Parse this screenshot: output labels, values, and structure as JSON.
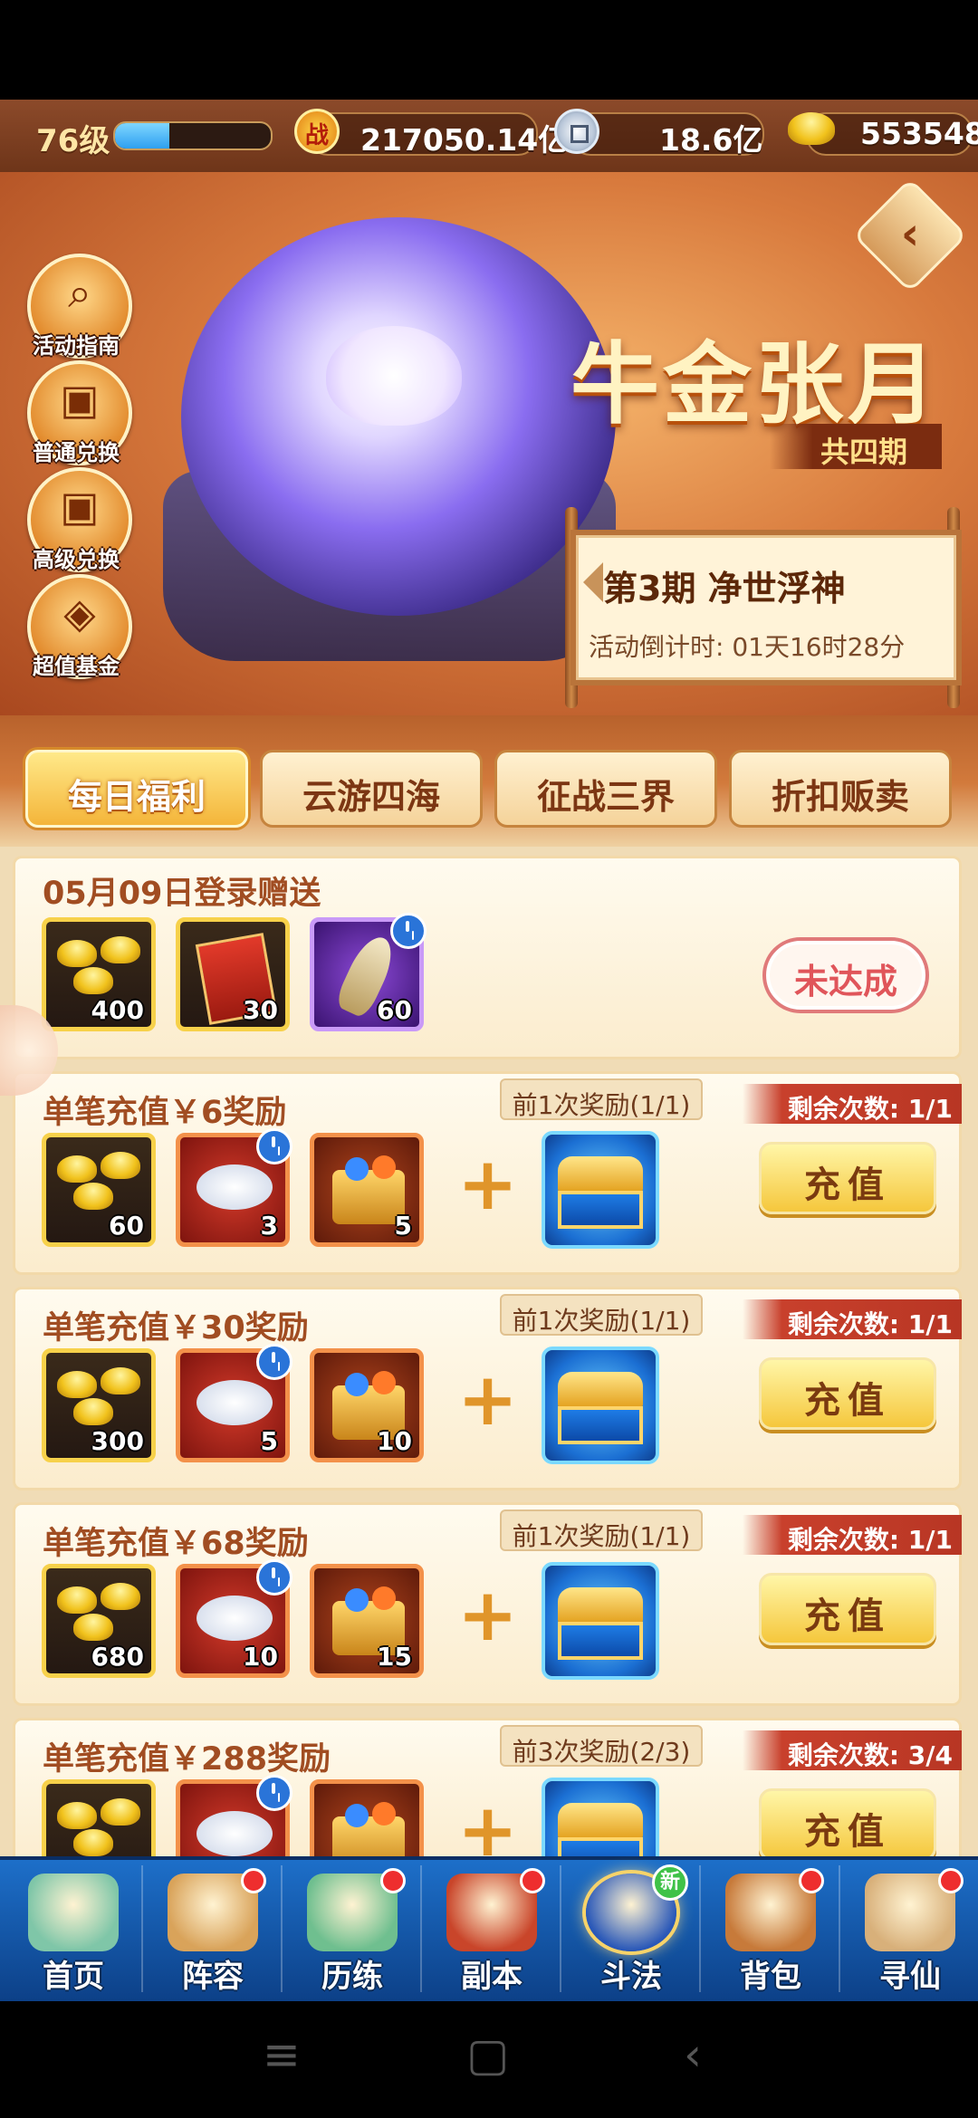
{
  "top_bar": {
    "level": "76级",
    "xp_progress": 0.35,
    "combat_icon": "战",
    "combat_power": "217050.14亿",
    "silver": "18.6亿",
    "gold": "553548"
  },
  "side_menu": [
    {
      "label": "活动指南",
      "icon": "magnifier-icon"
    },
    {
      "label": "普通兑换",
      "icon": "gift-box-icon"
    },
    {
      "label": "高级兑换",
      "icon": "gift-box-icon"
    },
    {
      "label": "超值基金",
      "icon": "treasure-icon"
    }
  ],
  "banner": {
    "title": "牛金张月",
    "subtitle": "共四期",
    "phase": "第3期  净世浮神",
    "countdown": "活动倒计时: 01天16时28分"
  },
  "tabs": [
    "每日福利",
    "云游四海",
    "征战三界",
    "折扣贩卖"
  ],
  "login_card": {
    "title": "05月09日登录赠送",
    "items": [
      {
        "type": "gold-ingot",
        "qty": "400"
      },
      {
        "type": "music-scroll",
        "qty": "30"
      },
      {
        "type": "bamboo-shoot",
        "qty": "60"
      }
    ],
    "status": "未达成"
  },
  "recharge_cards": [
    {
      "title": "单笔充值￥6奖励",
      "first_reward": "前1次奖励(1/1)",
      "remaining": "剩余次数: 1/1",
      "items": [
        {
          "qty": "60"
        },
        {
          "qty": "3"
        },
        {
          "qty": "5"
        }
      ],
      "button": "充值"
    },
    {
      "title": "单笔充值￥30奖励",
      "first_reward": "前1次奖励(1/1)",
      "remaining": "剩余次数: 1/1",
      "items": [
        {
          "qty": "300"
        },
        {
          "qty": "5"
        },
        {
          "qty": "10"
        }
      ],
      "button": "充值"
    },
    {
      "title": "单笔充值￥68奖励",
      "first_reward": "前1次奖励(1/1)",
      "remaining": "剩余次数: 1/1",
      "items": [
        {
          "qty": "680"
        },
        {
          "qty": "10"
        },
        {
          "qty": "15"
        }
      ],
      "button": "充值"
    },
    {
      "title": "单笔充值￥288奖励",
      "first_reward": "前3次奖励(2/3)",
      "remaining": "剩余次数: 3/4",
      "items": [
        {
          "qty": ""
        },
        {
          "qty": ""
        },
        {
          "qty": ""
        }
      ],
      "button": "充值"
    }
  ],
  "bottom_nav": [
    {
      "label": "首页",
      "badge": ""
    },
    {
      "label": "阵容",
      "badge": "dot"
    },
    {
      "label": "历练",
      "badge": "dot"
    },
    {
      "label": "副本",
      "badge": "dot"
    },
    {
      "label": "斗法",
      "badge": "新"
    },
    {
      "label": "背包",
      "badge": "dot"
    },
    {
      "label": "寻仙",
      "badge": "dot"
    }
  ],
  "colors": {
    "accent_gold": "#f4b53a",
    "title_brown": "#a14d22",
    "alert_red": "#c8402c",
    "nav_blue": "#1d6fc9"
  }
}
